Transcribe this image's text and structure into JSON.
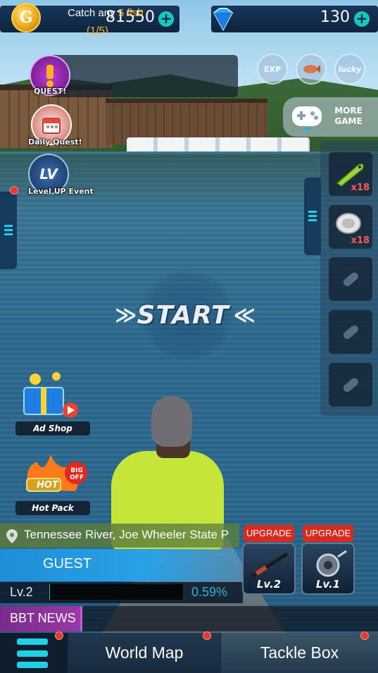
{
  "currency": {
    "coins": "81550",
    "coin_symbol": "G",
    "gems": "130"
  },
  "quest": {
    "label": "QUEST!",
    "text_prefix": "Catch any ",
    "text_highlight": "5 fish",
    "progress": "(1/5)"
  },
  "left_menu": {
    "daily_quest": "Daily Quest!",
    "level_up_event": "Level UP Event",
    "level_icon_text": "LV"
  },
  "top_right": {
    "exp_label": "EXP",
    "lucky_label": "lucky",
    "more_game": "MORE GAME"
  },
  "items": [
    {
      "name": "lure",
      "count": "x18"
    },
    {
      "name": "line",
      "count": "x18"
    },
    {
      "name": "empty",
      "count": ""
    },
    {
      "name": "empty",
      "count": ""
    },
    {
      "name": "empty",
      "count": ""
    }
  ],
  "start": {
    "label": "START"
  },
  "promos": {
    "ad_shop": "Ad Shop",
    "hot_pack": "Hot Pack",
    "hot_badge": "HOT",
    "big_off_badge": "BIG OFF"
  },
  "player": {
    "location": "Tennessee River, Joe Wheeler State P",
    "name": "GUEST",
    "level": "Lv.2",
    "xp_percent": "0.59%",
    "xp_fraction": 0.0059
  },
  "equipment": {
    "rod_upgrade": "UPGRADE",
    "rod_level": "Lv.2",
    "reel_upgrade": "UPGRADE",
    "reel_level": "Lv.1"
  },
  "news": {
    "label": "BBT NEWS"
  },
  "nav": {
    "world_map": "World Map",
    "tackle_box": "Tackle Box"
  },
  "colors": {
    "accent_cyan": "#1fd1e3",
    "highlight_orange": "#ffbb24",
    "upgrade_red": "#d82a1e"
  }
}
